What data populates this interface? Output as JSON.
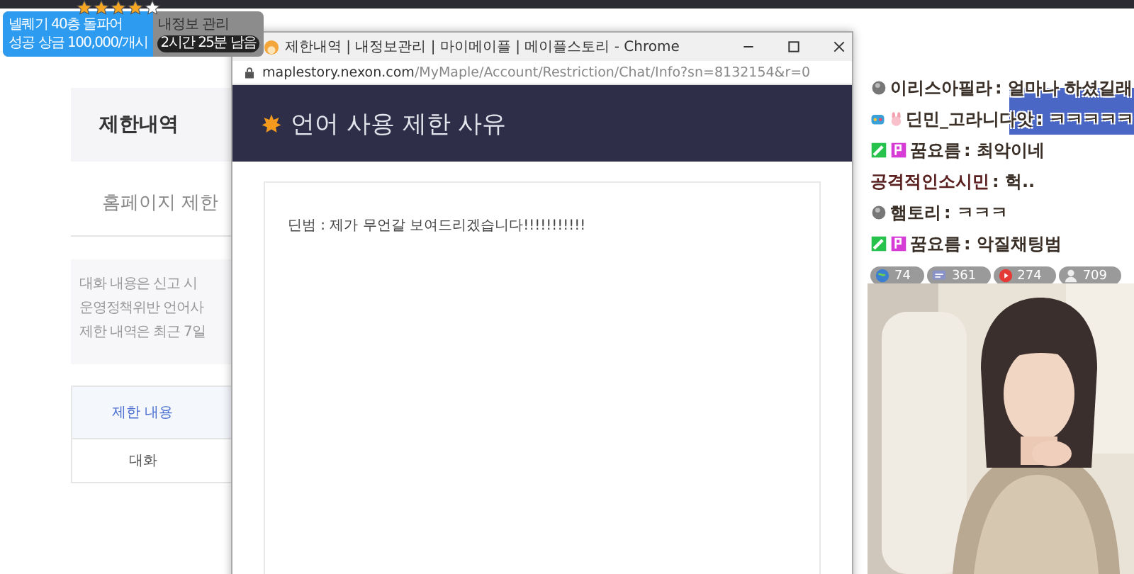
{
  "top_widget": {
    "mission": "넬퀘기 40층 돌파어",
    "reward": "성공 상금 100,000/개시",
    "stars": 4,
    "title": "내정보 관리",
    "timer": "2시간 25분 남음"
  },
  "page": {
    "heading": "제한내역",
    "subheading": "홈페이지 제한",
    "notices": [
      "대화 내용은 신고 시",
      "운영정책위반 언어사",
      "제한 내역은 최근 7일"
    ],
    "table": {
      "columns": [
        "제한 내용"
      ],
      "rows": [
        [
          "대화"
        ]
      ]
    }
  },
  "popup": {
    "title": "제한내역 | 내정보관리 | 마이메이플 | 메이플스토리 - Chrome",
    "url_host": "maplestory.nexon.com",
    "url_path": "/MyMaple/Account/Restriction/Chat/Info?sn=8132154&r=0",
    "heading": "언어 사용 제한 사유",
    "message": "딘범 : 제가 무언갈 보여드리겠습니다!!!!!!!!!!!"
  },
  "chat": {
    "messages": [
      {
        "badges": [
          {
            "kind": "orb"
          }
        ],
        "name": "이리스아필라",
        "text": ": 얼마나 하셨길래"
      },
      {
        "badges": [
          {
            "kind": "game"
          },
          {
            "kind": "bunny"
          }
        ],
        "name": "딘민_고라니다앗",
        "text": ": ㅋㅋㅋㅋㅋ"
      },
      {
        "badges": [
          {
            "kind": "pen"
          },
          {
            "kind": "p"
          }
        ],
        "name": "꿈요름",
        "text": ": 최악이네"
      },
      {
        "name": "공격적인소시민",
        "text": ": 헉.."
      },
      {
        "badges": [
          {
            "kind": "orb"
          }
        ],
        "name": "햄토리",
        "text": ": ㅋㅋㅋ"
      },
      {
        "badges": [
          {
            "kind": "pen"
          },
          {
            "kind": "p"
          }
        ],
        "name": "꿈요름",
        "text": ": 악질채팅범"
      }
    ],
    "stats": [
      {
        "kind": "globe",
        "count": "74"
      },
      {
        "kind": "chat",
        "count": "361"
      },
      {
        "kind": "play",
        "count": "274"
      },
      {
        "kind": "person",
        "count": "709"
      }
    ]
  }
}
